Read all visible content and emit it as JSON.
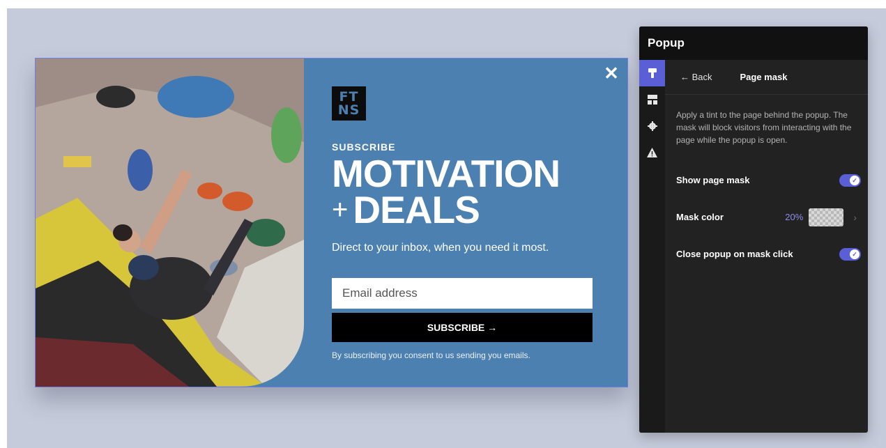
{
  "popup": {
    "close_glyph": "✕",
    "logo_line1": "FT",
    "logo_line2": "NS",
    "eyebrow": "SUBSCRIBE",
    "headline_line1": "MOTIVATION",
    "headline_plus": "+",
    "headline_line2": "DEALS",
    "subtext": "Direct to your inbox, when you need it most.",
    "email_placeholder": "Email address",
    "submit_label": "SUBSCRIBE →",
    "consent": "By subscribing you consent to us sending you emails."
  },
  "panel": {
    "title": "Popup",
    "rail_icons": [
      "paint-brush-icon",
      "layout-icon",
      "gear-icon",
      "warning-icon"
    ],
    "back_label": "← Back",
    "section_title": "Page mask",
    "description": "Apply a tint to the page behind the popup. The mask will block visitors from interacting with the page while the popup is open.",
    "show_mask_label": "Show page mask",
    "show_mask_on": true,
    "mask_color_label": "Mask color",
    "mask_opacity": "20%",
    "close_on_click_label": "Close popup on mask click",
    "close_on_click_on": true
  },
  "colors": {
    "canvas": "#c6cbdb",
    "popup_bg": "#4c80b0",
    "accent": "#5b5fd6",
    "panel_bg": "#222222"
  }
}
